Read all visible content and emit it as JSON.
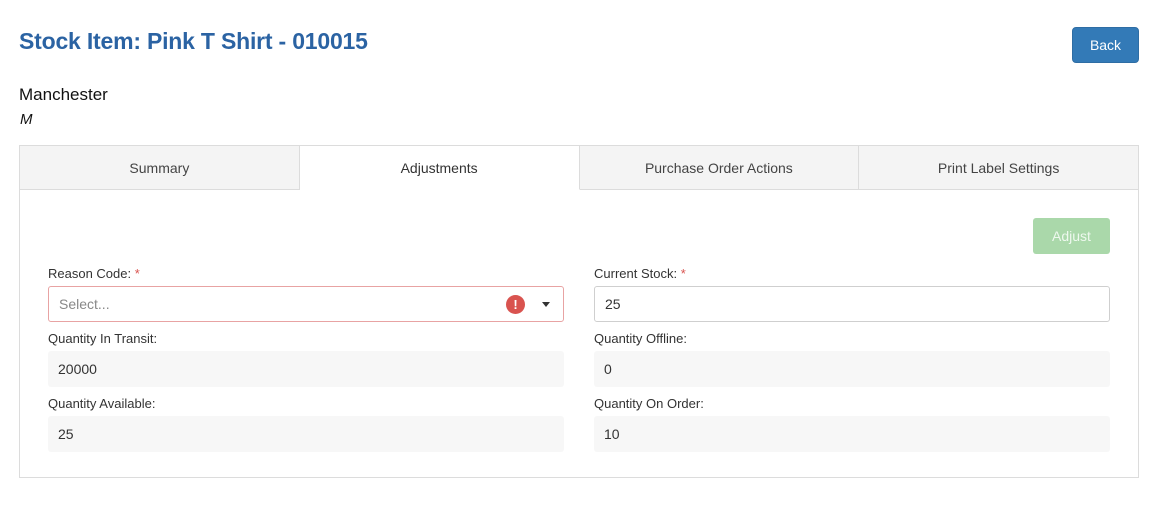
{
  "header": {
    "title": "Stock Item: Pink T Shirt - 010015",
    "back_label": "Back",
    "location": "Manchester",
    "size": "M"
  },
  "tabs": [
    {
      "label": "Summary",
      "active": false
    },
    {
      "label": "Adjustments",
      "active": true
    },
    {
      "label": "Purchase Order Actions",
      "active": false
    },
    {
      "label": "Print Label Settings",
      "active": false
    }
  ],
  "adjustments": {
    "adjust_label": "Adjust",
    "reason_code": {
      "label": "Reason Code:",
      "required": "*",
      "placeholder": "Select..."
    },
    "current_stock": {
      "label": "Current Stock:",
      "required": "*",
      "value": "25"
    },
    "quantity_in_transit": {
      "label": "Quantity In Transit:",
      "value": "20000"
    },
    "quantity_offline": {
      "label": "Quantity Offline:",
      "value": "0"
    },
    "quantity_available": {
      "label": "Quantity Available:",
      "value": "25"
    },
    "quantity_on_order": {
      "label": "Quantity On Order:",
      "value": "10"
    }
  },
  "colors": {
    "title": "#2b63a3",
    "primary_button": "#337ab7",
    "adjust_button_disabled": "#aad8aa",
    "error": "#d9534f"
  },
  "icons": {
    "error": "exclamation-circle-icon",
    "dropdown": "caret-down-icon"
  }
}
